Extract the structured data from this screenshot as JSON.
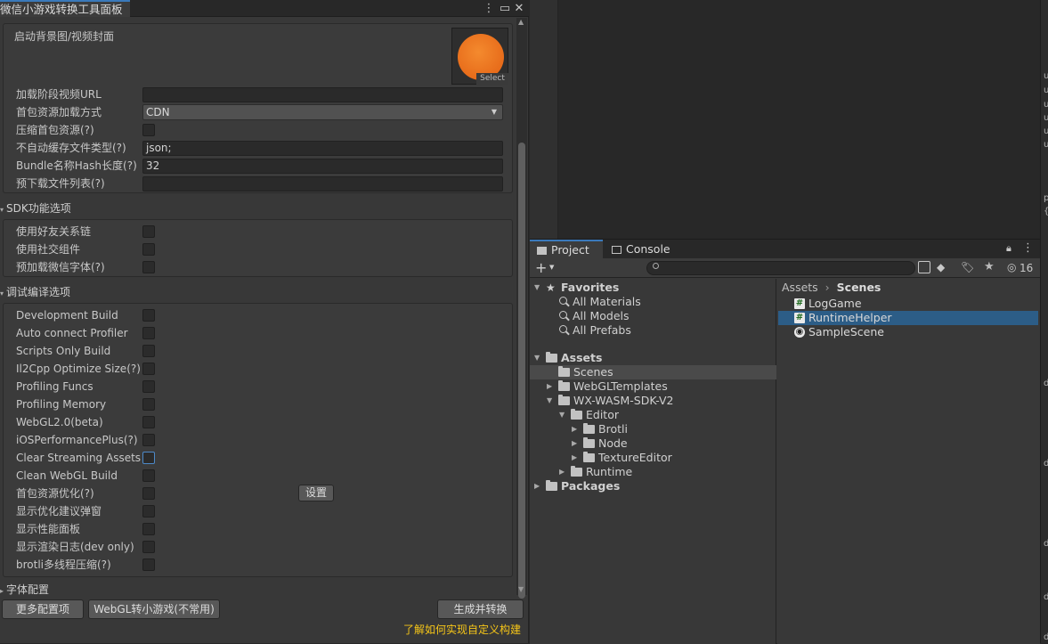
{
  "window": {
    "title": "微信小游戏转换工具面板",
    "menu_icon": "kebab-icon",
    "maximize_icon": "maximize-icon",
    "close_icon": "close-icon"
  },
  "cover": {
    "label": "启动背景图/视频封面",
    "select_label": "Select",
    "thumb_color": "#e8651b"
  },
  "fields": [
    {
      "label": "加载阶段视频URL",
      "value": ""
    },
    {
      "label": "首包资源加载方式",
      "value": "CDN",
      "type": "dropdown"
    },
    {
      "label": "压缩首包资源(?)",
      "type": "checkbox"
    },
    {
      "label": "不自动缓存文件类型(?)",
      "value": "json;"
    },
    {
      "label": "Bundle名称Hash长度(?)",
      "value": "32"
    },
    {
      "label": "预下载文件列表(?)",
      "value": ""
    }
  ],
  "sdk_section": {
    "title": "SDK功能选项",
    "items": [
      "使用好友关系链",
      "使用社交组件",
      "预加载微信字体(?)"
    ]
  },
  "debug_section": {
    "title": "调试编译选项",
    "items": [
      "Development Build",
      "Auto connect Profiler",
      "Scripts Only Build",
      "Il2Cpp Optimize Size(?)",
      "Profiling Funcs",
      "Profiling Memory",
      "WebGL2.0(beta)",
      "iOSPerformancePlus(?)",
      "Clear Streaming Assets",
      "Clean WebGL Build",
      "首包资源优化(?)",
      "显示优化建议弹窗",
      "显示性能面板",
      "显示渲染日志(dev only)",
      "brotli多线程压缩(?)"
    ],
    "settings_button": "设置"
  },
  "font_section": {
    "title": "字体配置"
  },
  "footer": {
    "more_config": "更多配置项",
    "webgl_convert": "WebGL转小游戏(不常用)",
    "generate": "生成并转换",
    "link": "了解如何实现自定义构建",
    "link_color": "#f5c518"
  },
  "project": {
    "tabs": [
      "Project",
      "Console"
    ],
    "hidden_count": "16",
    "favorites": {
      "label": "Favorites",
      "items": [
        "All Materials",
        "All Models",
        "All Prefabs"
      ]
    },
    "tree": [
      {
        "label": "Assets",
        "level": 0,
        "bold": true
      },
      {
        "label": "Scenes",
        "level": 1,
        "selected": true
      },
      {
        "label": "WebGLTemplates",
        "level": 1
      },
      {
        "label": "WX-WASM-SDK-V2",
        "level": 1
      },
      {
        "label": "Editor",
        "level": 2
      },
      {
        "label": "Brotli",
        "level": 3
      },
      {
        "label": "Node",
        "level": 3
      },
      {
        "label": "TextureEditor",
        "level": 3
      },
      {
        "label": "Runtime",
        "level": 2
      },
      {
        "label": "Packages",
        "level": 0,
        "bold": true
      }
    ],
    "breadcrumb": {
      "root": "Assets",
      "current": "Scenes"
    },
    "files": [
      {
        "name": "LogGame",
        "kind": "script"
      },
      {
        "name": "RuntimeHelper",
        "kind": "script",
        "selected": true
      },
      {
        "name": "SampleScene",
        "kind": "scene"
      }
    ]
  },
  "edge_strip": {
    "letters": [
      "u",
      "u",
      "u",
      "u",
      "u",
      "u",
      "p",
      "{",
      "d",
      "d",
      "d",
      "d",
      "d"
    ]
  }
}
